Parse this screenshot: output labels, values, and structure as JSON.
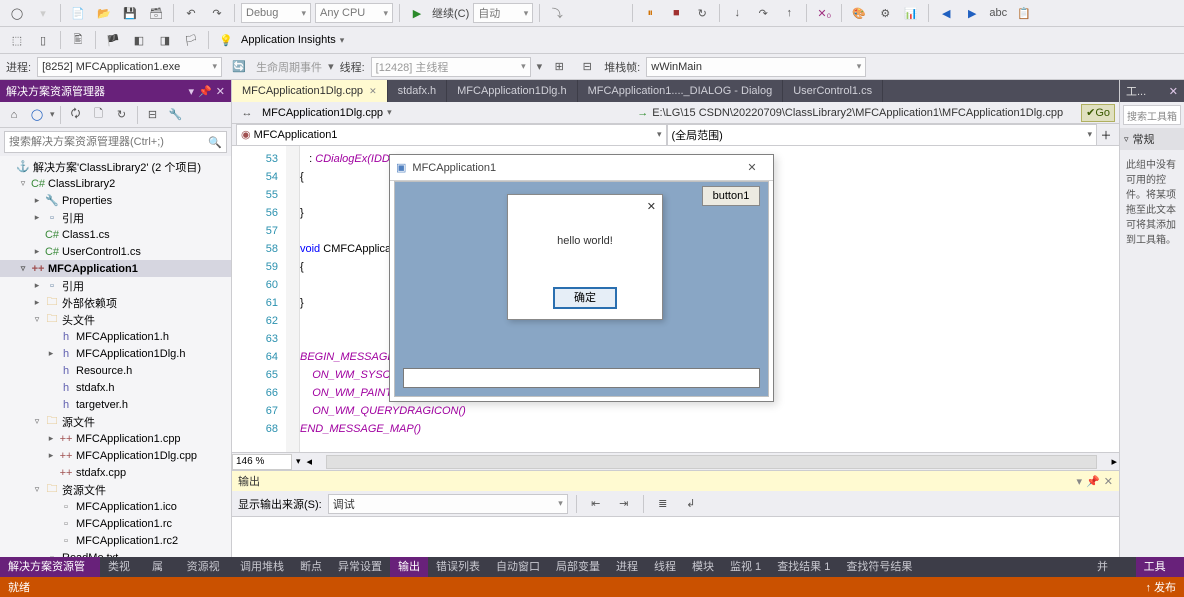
{
  "toolbar1": {
    "config": "Debug",
    "platform": "Any CPU",
    "run": "继续(C)",
    "mode": "自动",
    "insights": "Application Insights"
  },
  "toolbar2": {
    "proc_lbl": "进程:",
    "proc_val": "[8252] MFCApplication1.exe",
    "life_lbl": "生命周期事件",
    "thread_lbl": "线程:",
    "thread_val": "[12428] 主线程",
    "frame_lbl": "堆栈帧:",
    "frame_val": "wWinMain"
  },
  "sln": {
    "title": "解决方案资源管理器",
    "search_ph": "搜索解决方案资源管理器(Ctrl+;)",
    "root": "解决方案'ClassLibrary2' (2 个项目)",
    "items": [
      {
        "d": 1,
        "ex": "▿",
        "ic": "csproj",
        "t": "ClassLibrary2"
      },
      {
        "d": 2,
        "ex": "▸",
        "ic": "prop",
        "t": "Properties"
      },
      {
        "d": 2,
        "ex": "▸",
        "ic": "ref",
        "t": "引用"
      },
      {
        "d": 2,
        "ex": "",
        "ic": "cs",
        "t": "Class1.cs"
      },
      {
        "d": 2,
        "ex": "▸",
        "ic": "cs",
        "t": "UserControl1.cs"
      },
      {
        "d": 1,
        "ex": "▿",
        "ic": "cpp",
        "t": "MFCApplication1",
        "bold": true,
        "sel": true
      },
      {
        "d": 2,
        "ex": "▸",
        "ic": "ref",
        "t": "引用"
      },
      {
        "d": 2,
        "ex": "▸",
        "ic": "fold",
        "t": "外部依赖项"
      },
      {
        "d": 2,
        "ex": "▿",
        "ic": "fold",
        "t": "头文件"
      },
      {
        "d": 3,
        "ex": "",
        "ic": "h",
        "t": "MFCApplication1.h"
      },
      {
        "d": 3,
        "ex": "▸",
        "ic": "h",
        "t": "MFCApplication1Dlg.h"
      },
      {
        "d": 3,
        "ex": "",
        "ic": "h",
        "t": "Resource.h"
      },
      {
        "d": 3,
        "ex": "",
        "ic": "h",
        "t": "stdafx.h"
      },
      {
        "d": 3,
        "ex": "",
        "ic": "h",
        "t": "targetver.h"
      },
      {
        "d": 2,
        "ex": "▿",
        "ic": "fold",
        "t": "源文件"
      },
      {
        "d": 3,
        "ex": "▸",
        "ic": "cpp",
        "t": "MFCApplication1.cpp"
      },
      {
        "d": 3,
        "ex": "▸",
        "ic": "cpp",
        "t": "MFCApplication1Dlg.cpp"
      },
      {
        "d": 3,
        "ex": "",
        "ic": "cpp",
        "t": "stdafx.cpp"
      },
      {
        "d": 2,
        "ex": "▿",
        "ic": "fold",
        "t": "资源文件"
      },
      {
        "d": 3,
        "ex": "",
        "ic": "rc",
        "t": "MFCApplication1.ico"
      },
      {
        "d": 3,
        "ex": "",
        "ic": "rc",
        "t": "MFCApplication1.rc"
      },
      {
        "d": 3,
        "ex": "",
        "ic": "rc",
        "t": "MFCApplication1.rc2"
      },
      {
        "d": 2,
        "ex": "",
        "ic": "rc",
        "t": "ReadMe.txt"
      }
    ]
  },
  "tabs": [
    {
      "t": "MFCApplication1Dlg.cpp",
      "a": true,
      "x": true
    },
    {
      "t": "stdafx.h"
    },
    {
      "t": "MFCApplication1Dlg.h"
    },
    {
      "t": "MFCApplication1...._DIALOG - Dialog"
    },
    {
      "t": "UserControl1.cs"
    }
  ],
  "crumb": {
    "file": "MFCApplication1Dlg.cpp",
    "path": "E:\\LG\\15 CSDN\\20220709\\ClassLibrary2\\MFCApplication1\\MFCApplication1Dlg.cpp",
    "go": "Go",
    "scope_l": "MFCApplication1",
    "scope_r": "(全局范围)"
  },
  "code": {
    "start": 53,
    "lines": [
      {
        "n": 53,
        "html": "   : <span class='mac'>CDialogEx(IDD_MFCAPPLICATION1_DIALOG, pParent)</span>"
      },
      {
        "n": 54,
        "html": "{"
      },
      {
        "n": 55,
        "html": ""
      },
      {
        "n": 56,
        "html": "}"
      },
      {
        "n": 57,
        "html": ""
      },
      {
        "n": 58,
        "html": "<span class='kw'>void</span> <span class='ff'>CMFCApplication1Dlg::DoDataExchange(CDataExchange</span>* pDX)"
      },
      {
        "n": 59,
        "html": "{"
      },
      {
        "n": 60,
        "html": ""
      },
      {
        "n": 61,
        "html": "}"
      },
      {
        "n": 62,
        "html": ""
      },
      {
        "n": 63,
        "html": ""
      },
      {
        "n": 64,
        "html": "<span class='mac'>BEGIN_MESSAGE_MAP(CMFCApplication1Dlg, CDialogEx)</span>"
      },
      {
        "n": 65,
        "html": "    <span class='mac'>ON_WM_SYSCOMMAND()</span>"
      },
      {
        "n": 66,
        "html": "    <span class='mac'>ON_WM_PAINT()</span>"
      },
      {
        "n": 67,
        "html": "    <span class='mac'>ON_WM_QUERYDRAGICON()</span>"
      },
      {
        "n": 68,
        "html": "<span class='mac'>END_MESSAGE_MAP()</span>"
      }
    ],
    "zoom": "146 %"
  },
  "mfc": {
    "title": "MFCApplication1",
    "button": "button1",
    "msg": "hello world!",
    "ok": "确定"
  },
  "output": {
    "title": "输出",
    "src_lbl": "显示输出来源(S):",
    "src_val": "调试"
  },
  "right": {
    "title": "工...",
    "search_ph": "搜索工具箱",
    "section": "常规",
    "msg": "此组中没有可用的控件。将某项拖至此文本可将其添加到工具箱。"
  },
  "wintabs_l": [
    "解决方案资源管理器",
    "类视图",
    "属性",
    "资源视图"
  ],
  "wintabs_c": [
    "调用堆栈",
    "断点",
    "异常设置",
    "输出",
    "错误列表",
    "自动窗口",
    "局部变量",
    "进程",
    "线程",
    "模块",
    "监视 1",
    "查找结果 1",
    "查找符号结果"
  ],
  "wintabs_r": [
    "并行...",
    "工具箱"
  ],
  "status": {
    "l": "就绪",
    "r1": "↑ 发布"
  }
}
